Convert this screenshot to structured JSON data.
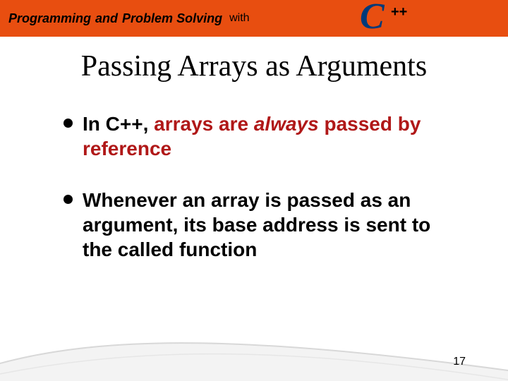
{
  "header": {
    "word1": "Programming",
    "and": "and",
    "word2": "Problem Solving",
    "with": "with",
    "logo_c": "C",
    "logo_pp": "++"
  },
  "title": "Passing Arrays as Arguments",
  "bullets": [
    {
      "pre": "In C++, ",
      "red_pre": "arrays are ",
      "red_italic": "always",
      "red_post": " passed by reference"
    },
    {
      "plain": "Whenever an array is passed as an argument, its base address is sent to the called function"
    }
  ],
  "page_number": "17"
}
